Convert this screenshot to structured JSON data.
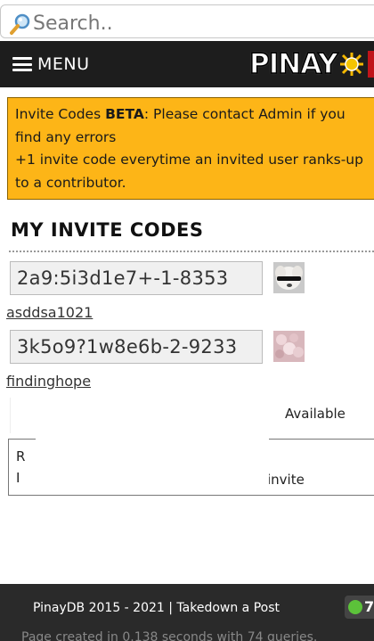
{
  "search": {
    "placeholder": "Search.."
  },
  "nav": {
    "menu_label": "MENU",
    "logo_text": "PINAY",
    "brand_accent": "#fdb517"
  },
  "notice": {
    "line1_prefix": "Invite Codes ",
    "line1_bold": "BETA",
    "line1_suffix": ": Please contact Admin if you find any errors",
    "line2": "+1 invite code everytime an invited user ranks-up to a contributor."
  },
  "section": {
    "title": "MY INVITE CODES"
  },
  "invites": [
    {
      "code": "2a9:5i3d1e7+-1-8353",
      "username": "asddsa1021",
      "avatar": "dog-avatar"
    },
    {
      "code": "3k5o9?1w8e6b-2-9233",
      "username": "findinghope",
      "avatar": "flowers-avatar"
    }
  ],
  "available_label": "Available",
  "invite_panel": {
    "line1": "R",
    "line2": "I",
    "invite_word": "invite"
  },
  "footer": {
    "text": "PinayDB 2015 - 2021 | Takedown a Post",
    "online_count": "7",
    "subtext": "Page created in 0.138 seconds with 74 queries."
  }
}
